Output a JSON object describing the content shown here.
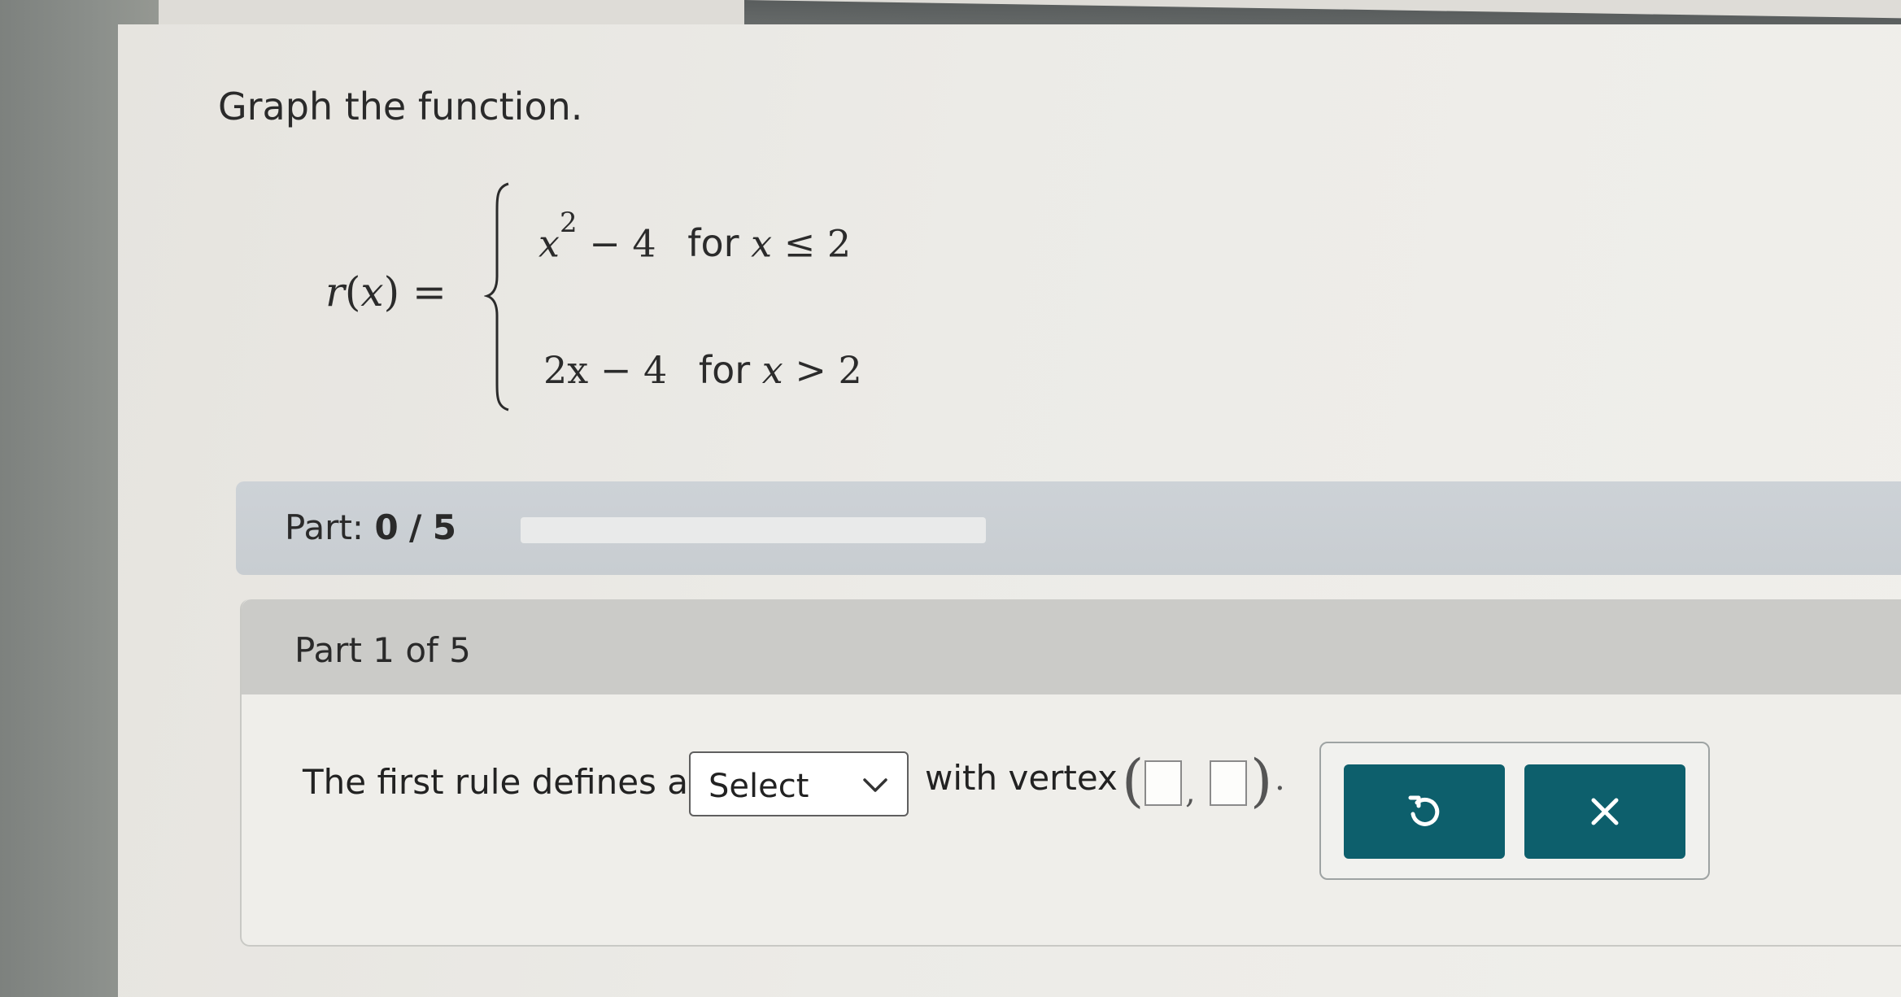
{
  "problem": {
    "instruction": "Graph the function."
  },
  "equation": {
    "lhs_name": "r",
    "lhs_var": "x",
    "equals": "=",
    "cases": [
      {
        "expr_base": "x",
        "expr_exp": "2",
        "expr_rest": " − 4",
        "word": "for",
        "cond_var": "x",
        "cond_op": " ≤ ",
        "cond_val": "2"
      },
      {
        "expr_base": "2x",
        "expr_exp": "",
        "expr_rest": " − 4",
        "word": "for",
        "cond_var": "x",
        "cond_op": " > ",
        "cond_val": "2"
      }
    ]
  },
  "progress": {
    "label": "Part:",
    "current": "0",
    "separator": "/",
    "total": "5",
    "fraction": 0.0
  },
  "part": {
    "title": "Part 1 of 5",
    "prompt_before": "The first rule defines a",
    "select_value": "Select",
    "prompt_after": "with vertex",
    "vertex_open": "(",
    "vertex_comma": ",",
    "vertex_close": ")",
    "vertex_period": "."
  },
  "icons": {
    "undo": "undo-icon",
    "clear": "close-icon",
    "chevron": "chevron-down-icon"
  },
  "colors": {
    "accent": "#0d5f6c",
    "progress_track": "#e9eaea"
  }
}
